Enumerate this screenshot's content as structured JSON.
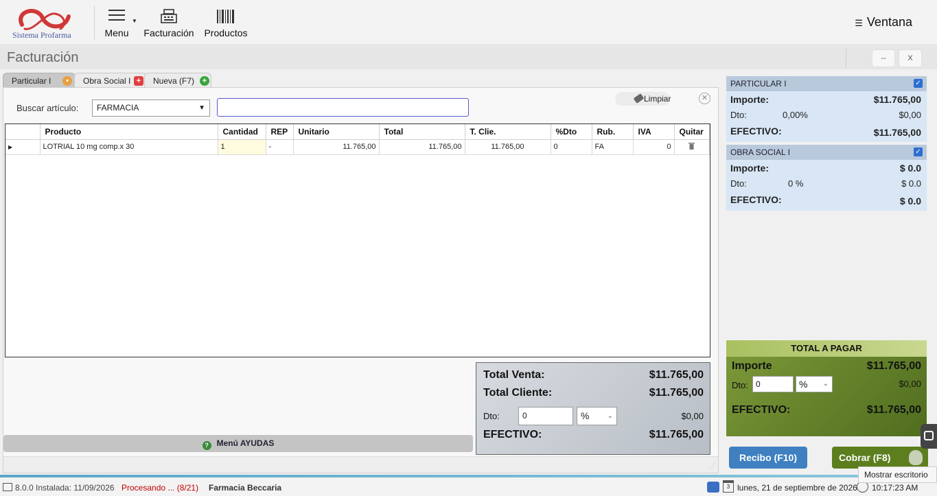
{
  "app": {
    "logo_text": "Sistema Profarma",
    "nav": {
      "menu_label": "Menu",
      "facturacion_label": "Facturación",
      "productos_label": "Productos"
    },
    "ventana_label": "Ventana"
  },
  "titlebar": {
    "title": "Facturación",
    "minimize_label": "--",
    "close_label": "X"
  },
  "tabs": [
    {
      "label": "Particular I",
      "icon": "user-icon"
    },
    {
      "label": "Obra Social I",
      "icon": "medical-cross-icon"
    },
    {
      "label": "Nueva (F7)",
      "icon": "add-icon"
    }
  ],
  "search": {
    "label": "Buscar artículo:",
    "category_value": "FARMACIA",
    "input_value": "",
    "clear_label": "Limpiar"
  },
  "grid": {
    "columns": [
      "Producto",
      "Cantidad",
      "REP",
      "Unitario",
      "Total",
      "T. Clie.",
      "%Dto",
      "Rub.",
      "IVA",
      "Quitar"
    ],
    "rows": [
      {
        "producto": "LOTRIAL 10 mg comp.x 30",
        "cantidad": "1",
        "rep": "-",
        "unitario": "11.765,00",
        "total": "11.765,00",
        "t_clie": "11.765,00",
        "dto": "0",
        "rub": "FA",
        "iva": "0"
      }
    ]
  },
  "totals": {
    "venta_label": "Total Venta:",
    "venta_value": "$11.765,00",
    "cliente_label": "Total Cliente:",
    "cliente_value": "$11.765,00",
    "dto_label": "Dto:",
    "dto_input": "0",
    "dto_unit": "%",
    "dto_value": "$0,00",
    "efectivo_label": "EFECTIVO:",
    "efectivo_value": "$11.765,00"
  },
  "ayudas_label": "Menú AYUDAS",
  "accounts": [
    {
      "name": "PARTICULAR I",
      "importe_label": "Importe:",
      "importe_value": "$11.765,00",
      "dto_label": "Dto:",
      "dto_pct": "0,00%",
      "dto_value": "$0,00",
      "efectivo_label": "EFECTIVO:",
      "efectivo_value": "$11.765,00"
    },
    {
      "name": "OBRA SOCIAL I",
      "importe_label": "Importe:",
      "importe_value": "$ 0.0",
      "dto_label": "Dto:",
      "dto_pct": "0 %",
      "dto_value": "$ 0.0",
      "efectivo_label": "EFECTIVO:",
      "efectivo_value": "$ 0.0"
    }
  ],
  "total_pagar": {
    "title": "TOTAL A PAGAR",
    "importe_label": "Importe",
    "importe_value": "$11.765,00",
    "dto_label": "Dto:",
    "dto_input": "0",
    "dto_unit": "%",
    "dto_value": "$0,00",
    "efectivo_label": "EFECTIVO:",
    "efectivo_value": "$11.765,00"
  },
  "buttons": {
    "recibo": "Recibo (F10)",
    "cobrar": "Cobrar (F8)"
  },
  "tooltip": "Mostrar escritorio",
  "statusbar": {
    "version": "8.0.0 Instalada: 11/09/2026",
    "processing": "Procesando ... (8/21)",
    "farmacia": "Farmacia Beccaria",
    "calendar_day": "3",
    "date": "lunes, 21 de septiembre de 2026",
    "time": "10:17:23 AM"
  }
}
